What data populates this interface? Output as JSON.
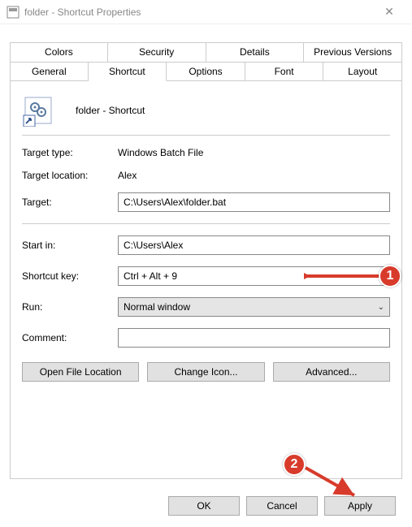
{
  "window": {
    "title": "folder - Shortcut Properties",
    "close_icon": "✕"
  },
  "tabs": {
    "row1": [
      "Colors",
      "Security",
      "Details",
      "Previous Versions"
    ],
    "row2": [
      "General",
      "Shortcut",
      "Options",
      "Font",
      "Layout"
    ],
    "active": "Shortcut"
  },
  "header": {
    "name": "folder - Shortcut"
  },
  "fields": {
    "target_type_label": "Target type:",
    "target_type_value": "Windows Batch File",
    "target_location_label": "Target location:",
    "target_location_value": "Alex",
    "target_label": "Target:",
    "target_value": "C:\\Users\\Alex\\folder.bat",
    "start_in_label": "Start in:",
    "start_in_value": "C:\\Users\\Alex",
    "shortcut_key_label": "Shortcut key:",
    "shortcut_key_value": "Ctrl + Alt + 9",
    "run_label": "Run:",
    "run_value": "Normal window",
    "comment_label": "Comment:",
    "comment_value": ""
  },
  "buttons": {
    "open_file_location": "Open File Location",
    "change_icon": "Change Icon...",
    "advanced": "Advanced...",
    "ok": "OK",
    "cancel": "Cancel",
    "apply": "Apply"
  },
  "annotations": {
    "step1": "1",
    "step2": "2"
  }
}
